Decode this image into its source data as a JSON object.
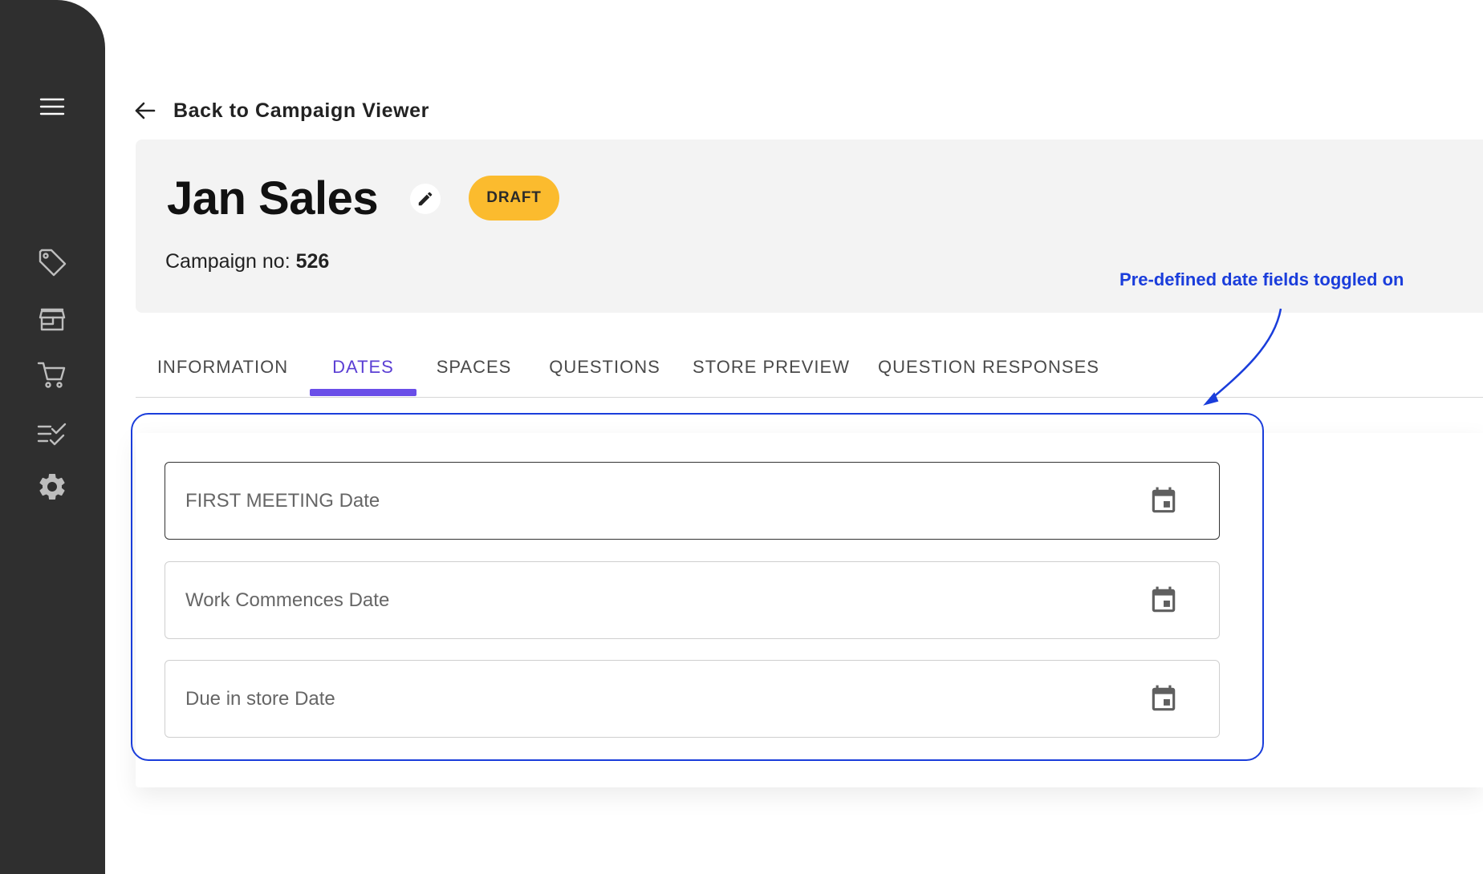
{
  "sidebar": {
    "items": [
      {
        "icon": "menu-icon"
      },
      {
        "icon": "tag-icon"
      },
      {
        "icon": "store-icon"
      },
      {
        "icon": "cart-icon"
      },
      {
        "icon": "checklist-icon"
      },
      {
        "icon": "gear-icon"
      }
    ]
  },
  "back_link": {
    "label": "Back to Campaign Viewer"
  },
  "campaign": {
    "title": "Jan Sales",
    "status": "DRAFT",
    "number_label": "Campaign no:",
    "number": "526"
  },
  "annotation": {
    "text": "Pre-defined date fields toggled on"
  },
  "tabs": [
    {
      "label": "INFORMATION"
    },
    {
      "label": "DATES"
    },
    {
      "label": "SPACES"
    },
    {
      "label": "QUESTIONS"
    },
    {
      "label": "STORE PREVIEW"
    },
    {
      "label": "QUESTION RESPONSES"
    }
  ],
  "active_tab": "DATES",
  "date_fields": [
    {
      "label": "FIRST MEETING Date",
      "value": ""
    },
    {
      "label": "Work Commences Date",
      "value": ""
    },
    {
      "label": "Due in store Date",
      "value": ""
    }
  ],
  "colors": {
    "sidebar": "#2f2f2f",
    "accent": "#6a4ee8",
    "status_badge": "#fbbb2e",
    "annotation": "#1a3ddb"
  }
}
